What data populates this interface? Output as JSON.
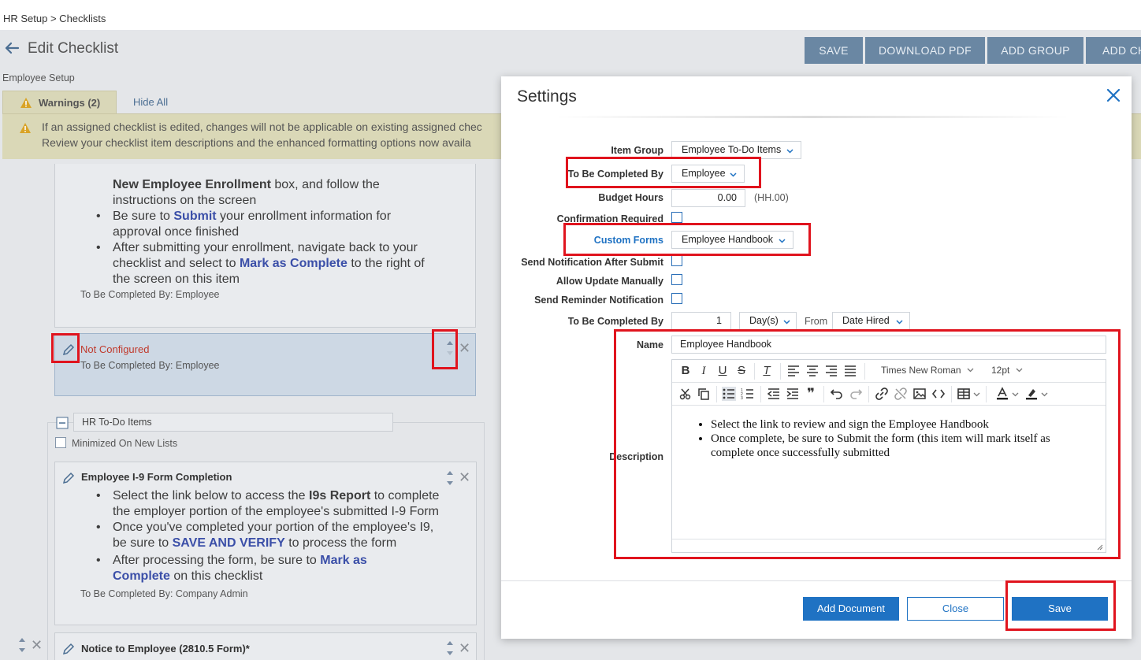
{
  "breadcrumb": "HR Setup > Checklists",
  "page": {
    "title": "Edit Checklist",
    "subtitle": "Employee Setup",
    "toolbar": {
      "save": "SAVE",
      "download_pdf": "DOWNLOAD PDF",
      "add_group": "ADD GROUP",
      "add_checklist_item": "ADD CH"
    }
  },
  "warnings": {
    "tab_label": "Warnings (2)",
    "hide_all": "Hide All",
    "line1": "If an assigned checklist is edited, changes will not be applicable on existing assigned chec",
    "line2": "Review your checklist item descriptions and the enhanced formatting options now availa"
  },
  "cards": {
    "enrollment": {
      "l1_bold": "New Employee Enrollment",
      "l1_rest": " box, and follow the",
      "l2": "instructions on the screen",
      "b1_a": "Be sure to ",
      "b1_link": "Submit",
      "b1_b": " your enrollment information for",
      "b1_c": "approval once finished",
      "b2_a": "After submitting your enrollment, navigate back to your",
      "b2_b": "checklist and select to ",
      "b2_link": "Mark as Complete",
      "b2_c": " to the right of",
      "b2_d": "the screen on this item",
      "completed_by": "To Be Completed By: Employee"
    },
    "not_configured": {
      "status": "Not Configured",
      "completed_by": "To Be Completed By: Employee"
    },
    "hr_group": {
      "name": "HR To-Do Items",
      "minimized_label": "Minimized On New Lists"
    },
    "i9": {
      "title": "Employee I-9 Form Completion",
      "b1_a": "Select the link below to access the ",
      "b1_bold": "I9s Report",
      "b1_b": " to complete",
      "b1_c": "the employer portion of the employee's submitted I-9 Form",
      "b2_a": "Once you've completed your portion of the employee's I9,",
      "b2_b": "be sure to ",
      "b2_link": "SAVE AND VERIFY",
      "b2_c": " to process the form",
      "b3_a": "After processing the form, be sure to ",
      "b3_link1": "Mark as",
      "b3_link2": "Complete",
      "b3_c": " on this checklist",
      "completed_by": "To Be Completed By: Company Admin"
    },
    "notice": {
      "title": "Notice to Employee (2810.5 Form)*"
    }
  },
  "settings_dialog": {
    "title": "Settings",
    "labels": {
      "item_group": "Item Group",
      "completed_by": "To Be Completed By",
      "budget_hours": "Budget Hours",
      "confirmation_required": "Confirmation Required",
      "custom_forms": "Custom Forms",
      "send_notification": "Send Notification After Submit",
      "allow_update": "Allow Update Manually",
      "send_reminder": "Send Reminder Notification",
      "completed_by_due": "To Be Completed By",
      "name": "Name",
      "description": "Description",
      "from": "From"
    },
    "values": {
      "item_group": "Employee To-Do Items",
      "completed_by": "Employee",
      "budget_hours": "0.00",
      "budget_hours_hint": "(HH.00)",
      "custom_forms": "Employee Handbook",
      "due_amount": "1",
      "due_unit": "Day(s)",
      "due_from": "Date Hired",
      "name": "Employee Handbook"
    },
    "editor": {
      "font_family": "Times New Roman",
      "font_size": "12pt",
      "bullets": [
        "Select the link to review and sign the Employee Handbook",
        "Once complete, be sure to Submit the form (this item will mark itself as complete once successfully submitted"
      ]
    },
    "buttons": {
      "add_document": "Add Document",
      "close": "Close",
      "save": "Save"
    }
  },
  "colors": {
    "primary": "#1f72c3",
    "highlight_red": "#e0141e",
    "warning_bg": "#dad8b7",
    "not_configured": "#c0392b",
    "link_blue": "#3b4fa8"
  }
}
